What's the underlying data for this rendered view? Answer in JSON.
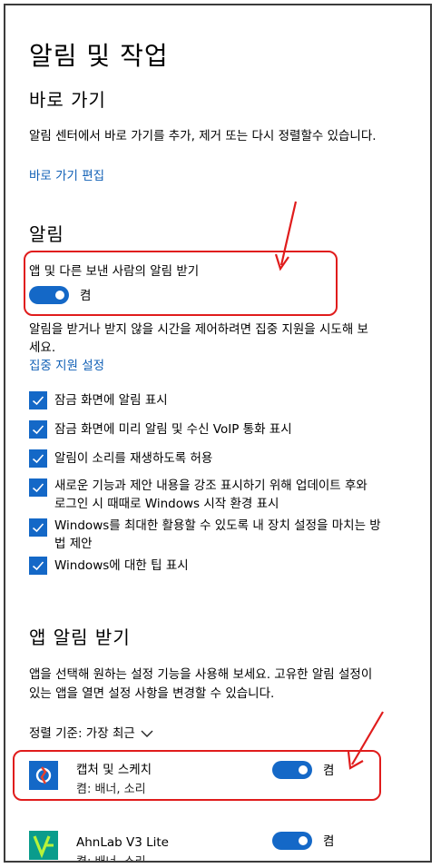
{
  "page": {
    "title": "알림 및 작업"
  },
  "quick_actions": {
    "heading": "바로 가기",
    "description": "알림 센터에서 바로 가기를 추가, 제거 또는 다시 정렬할수 있습니다.",
    "edit_link": "바로 가기 편집"
  },
  "notifications": {
    "heading": "알림",
    "get_notifications_label": "앱 및 다른 보낸 사람의 알림 받기",
    "toggle_state": "켬",
    "focus_desc_line1": "알림을 받거나 받지 않을 시간을 제어하려면 집중 지원을 시도해 보",
    "focus_desc_line2": "세요.",
    "focus_link": "집중 지원 설정",
    "checkboxes": [
      {
        "label": "잠금 화면에 알림 표시",
        "checked": true
      },
      {
        "label": "잠금 화면에 미리 알림 및 수신 VoIP 통화 표시",
        "checked": true
      },
      {
        "label": "알림이 소리를 재생하도록 허용",
        "checked": true
      },
      {
        "label_line1": "새로운 기능과 제안 내용을 강조 표시하기 위해 업데이트 후와",
        "label_line2": "로그인 시 때때로 Windows 시작 환경 표시",
        "checked": true
      },
      {
        "label_line1": "Windows를 최대한 활용할 수 있도록 내 장치 설정을 마치는 방",
        "label_line2": "법 제안",
        "checked": true
      },
      {
        "label": "Windows에 대한 팁 표시",
        "checked": true
      }
    ]
  },
  "app_notifications": {
    "heading": "앱 알림 받기",
    "desc_line1": "앱을 선택해 원하는 설정 기능을 사용해 보세요. 고유한 알림 설정이",
    "desc_line2": "있는 앱을 열면 설정 사항을 변경할 수 있습니다.",
    "sort_label": "정렬 기준: 가장 최근",
    "apps": [
      {
        "name": "캡처 및 스케치",
        "sub": "켬: 배너, 소리",
        "toggle_state": "켬"
      },
      {
        "name": "AhnLab V3 Lite",
        "sub": "켬: 배너, 소리",
        "toggle_state": "켬"
      }
    ]
  },
  "colors": {
    "accent": "#1468c7",
    "link": "#1160b6",
    "annotation": "#e01c1c"
  }
}
